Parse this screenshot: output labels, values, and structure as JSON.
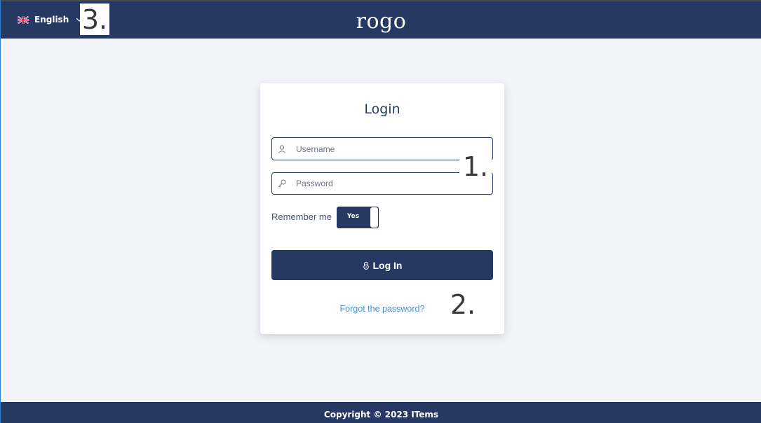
{
  "header": {
    "language": {
      "label": "English",
      "flag_icon": "uk-flag-icon",
      "chevron_icon": "chevron-down-icon"
    },
    "logo_text": "rogo",
    "colors": {
      "navbar": "#253962"
    }
  },
  "annotations": [
    {
      "id": "3",
      "label": "3."
    },
    {
      "id": "1",
      "label": "1."
    },
    {
      "id": "2",
      "label": "2."
    }
  ],
  "login": {
    "title": "Login",
    "username": {
      "placeholder": "Username",
      "value": "",
      "icon": "user-icon"
    },
    "password": {
      "placeholder": "Password",
      "value": "",
      "icon": "key-icon"
    },
    "remember": {
      "label": "Remember me",
      "toggle_label": "Yes",
      "checked": true
    },
    "submit": {
      "label": "Log In",
      "icon": "lock-icon"
    },
    "forgot_link": "Forgot the password?"
  },
  "footer": {
    "text": "Copyright © 2023 ITems"
  }
}
